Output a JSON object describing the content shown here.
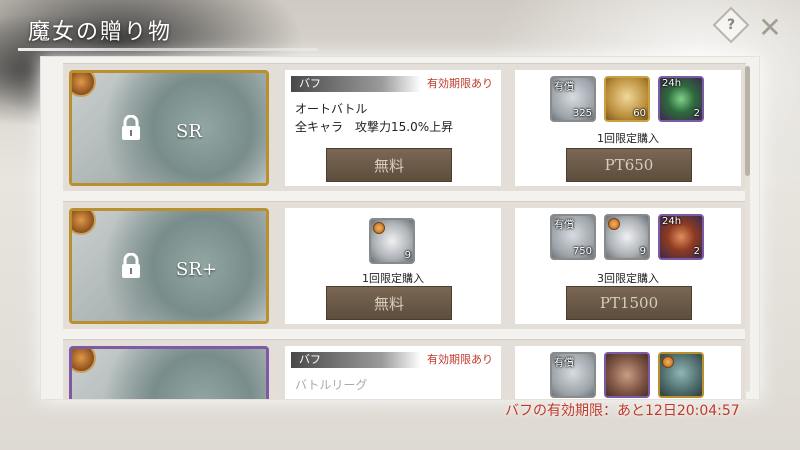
{
  "header": {
    "title": "魔女の贈り物"
  },
  "rows": [
    {
      "rarity": "SR",
      "buff_tag": "バフ",
      "expiry_tag": "有効期限あり",
      "buff_lines": [
        "オートバトル",
        "全キャラ　攻撃力15.0%上昇"
      ],
      "free_limit": "",
      "free_button": "無料",
      "items": [
        {
          "top": "有償",
          "count": "325",
          "icon": "crystal-icon"
        },
        {
          "top": "",
          "count": "60",
          "icon": "gold-item-icon"
        },
        {
          "top": "24h",
          "count": "2",
          "icon": "green-orb-icon"
        }
      ],
      "paid_limit": "1回限定購入",
      "paid_button": "PT650"
    },
    {
      "rarity": "SR+",
      "buff_tag": "",
      "expiry_tag": "",
      "buff_lines": [],
      "free_item": {
        "count": "9",
        "icon": "letter-icon"
      },
      "free_limit": "1回限定購入",
      "free_button": "無料",
      "items": [
        {
          "top": "有償",
          "count": "750",
          "icon": "crystal-icon"
        },
        {
          "top": "",
          "count": "9",
          "icon": "letter-icon"
        },
        {
          "top": "24h",
          "count": "2",
          "icon": "red-orb-icon"
        }
      ],
      "paid_limit": "3回限定購入",
      "paid_button": "PT1500"
    },
    {
      "rarity": "",
      "buff_tag": "バフ",
      "expiry_tag": "有効期限あり",
      "buff_lines": [
        "バトルリーグ"
      ],
      "items": [
        {
          "top": "有償",
          "count": "",
          "icon": "crystal-icon"
        },
        {
          "top": "",
          "count": "",
          "icon": "chest-icon"
        },
        {
          "top": "",
          "count": "",
          "icon": "portrait-icon"
        }
      ]
    }
  ],
  "footer": {
    "timer": "バフの有効期限：あと12日20:04:57"
  },
  "colors": {
    "accent_red": "#c0392b",
    "button_brown": "#6b5a47",
    "gold_border": "#b8902e",
    "purple_border": "#7d5aa3"
  }
}
